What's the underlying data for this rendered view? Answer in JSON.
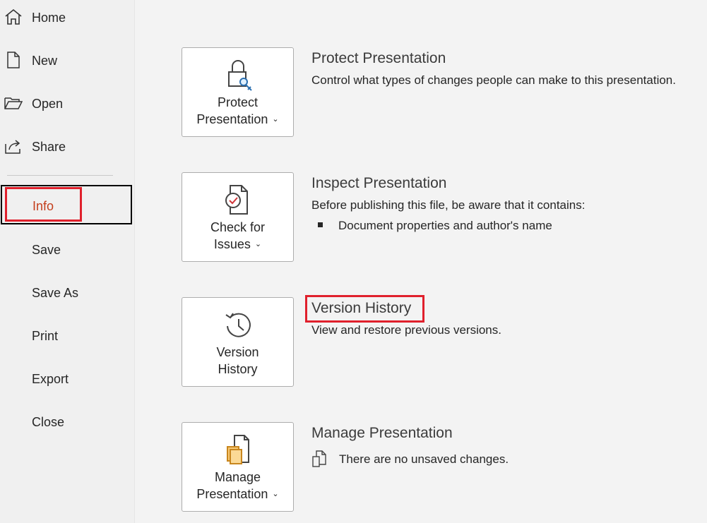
{
  "sidebar": {
    "items": [
      {
        "label": "Home",
        "icon": "home-icon"
      },
      {
        "label": "New",
        "icon": "new-document-icon"
      },
      {
        "label": "Open",
        "icon": "open-folder-icon"
      },
      {
        "label": "Share",
        "icon": "share-icon"
      },
      {
        "label": "Info",
        "icon": "",
        "active": true
      },
      {
        "label": "Save"
      },
      {
        "label": "Save As"
      },
      {
        "label": "Print"
      },
      {
        "label": "Export"
      },
      {
        "label": "Close"
      }
    ]
  },
  "main": {
    "protect": {
      "button_line1": "Protect",
      "button_line2": "Presentation",
      "title": "Protect Presentation",
      "description": "Control what types of changes people can make to this presentation.",
      "icon": "lock-key-icon"
    },
    "inspect": {
      "button_line1": "Check for",
      "button_line2": "Issues",
      "title": "Inspect Presentation",
      "description": "Before publishing this file, be aware that it contains:",
      "bullets": [
        "Document properties and author's name"
      ],
      "icon": "check-document-icon"
    },
    "version": {
      "button_line1": "Version",
      "button_line2": "History",
      "title": "Version History",
      "description": "View and restore previous versions.",
      "icon": "history-clock-icon"
    },
    "manage": {
      "button_line1": "Manage",
      "button_line2": "Presentation",
      "title": "Manage Presentation",
      "description": "There are no unsaved changes.",
      "icon": "manage-documents-icon"
    }
  },
  "colors": {
    "active_text": "#c43e1c",
    "highlight": "#e0202c",
    "background": "#f3f3f3"
  }
}
